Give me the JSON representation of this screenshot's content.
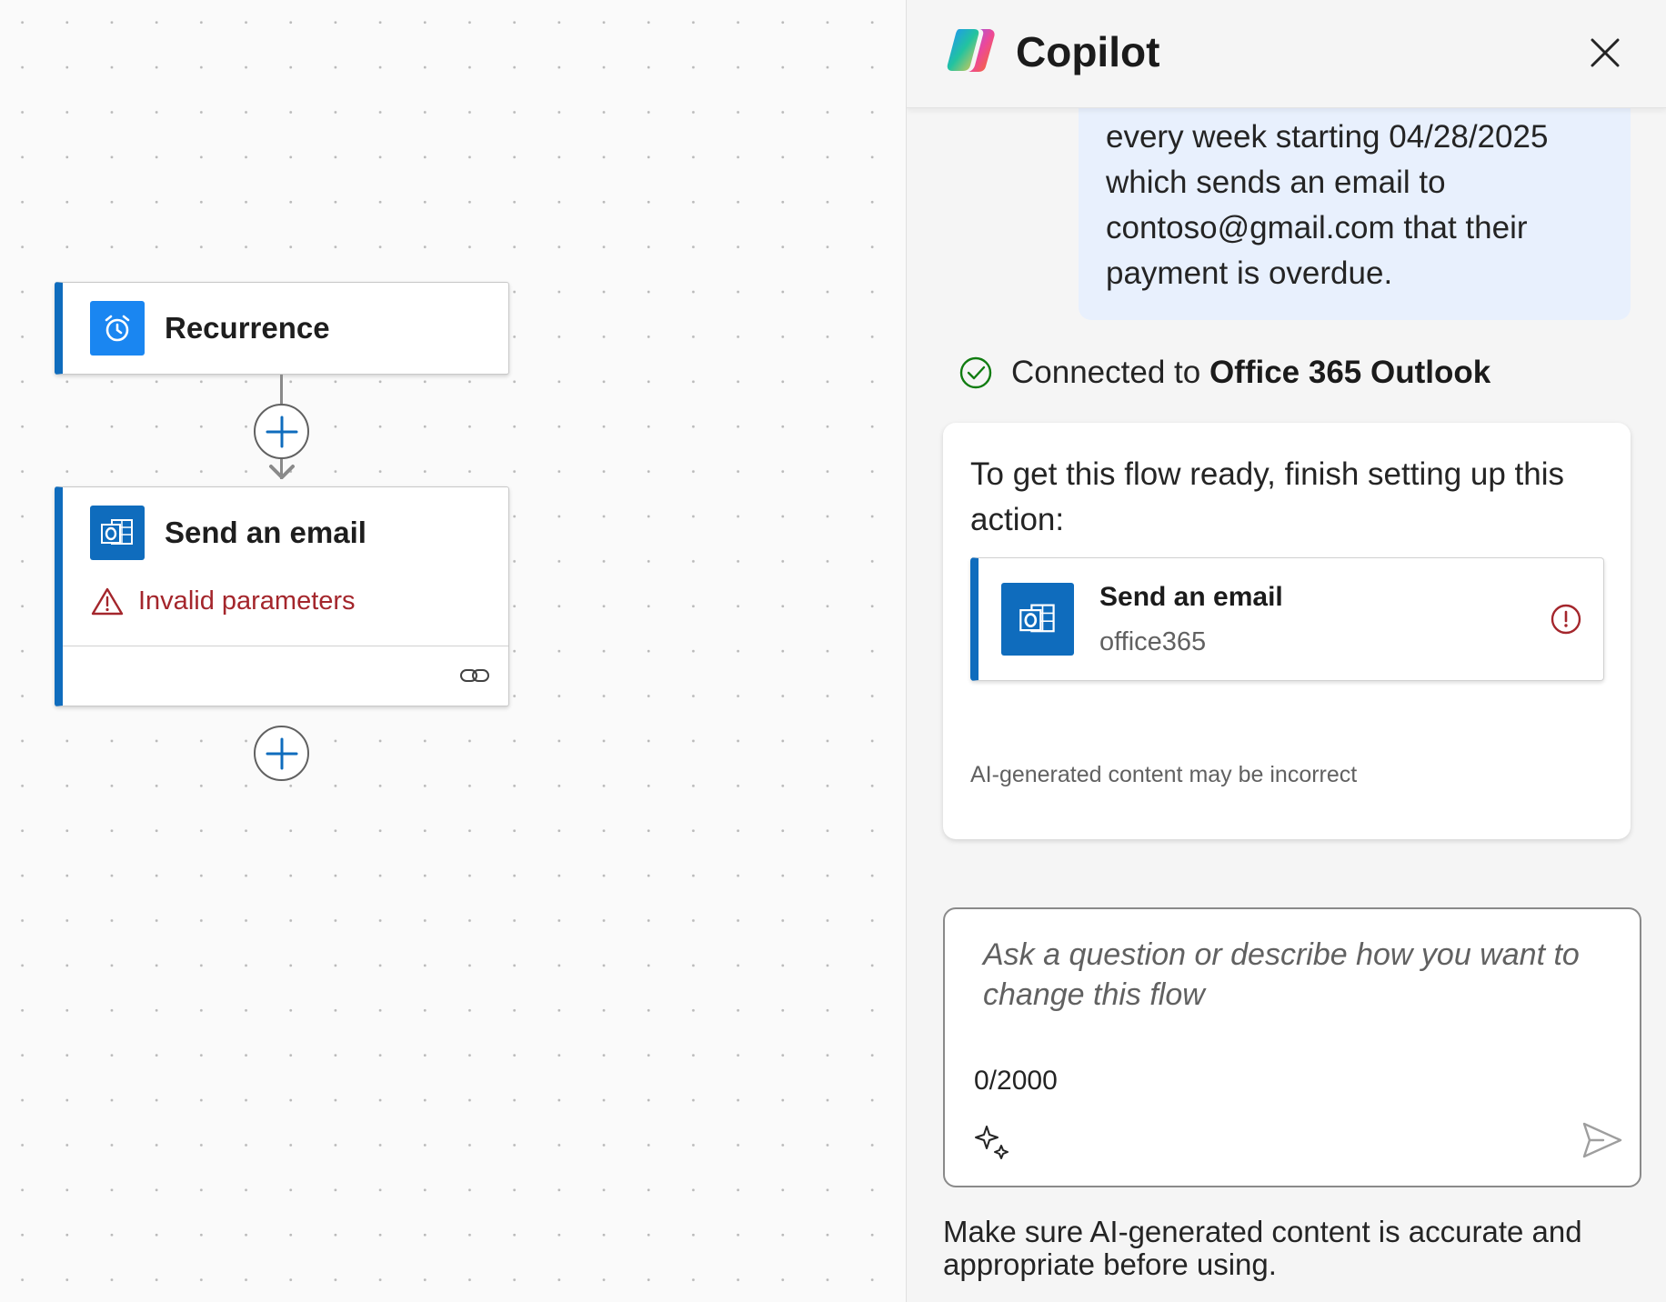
{
  "canvas": {
    "nodes": [
      {
        "title": "Recurrence",
        "icon": "alarm-clock-icon"
      },
      {
        "title": "Send an email",
        "icon": "outlook-icon",
        "error": "Invalid parameters",
        "footer_icon": "link-icon"
      }
    ],
    "add_buttons": [
      "plus-icon",
      "plus-icon"
    ]
  },
  "copilot": {
    "title": "Copilot",
    "user_message": "every week starting 04/28/2025 which sends an email to contoso@gmail.com that their payment is overdue.",
    "connected_prefix": "Connected to",
    "connected_service": "Office 365 Outlook",
    "setup_prompt": "To get this flow ready, finish setting up this action:",
    "action": {
      "title": "Send an email",
      "connector": "office365",
      "status_icon": "error-circle-icon"
    },
    "ai_note": "AI-generated content may be incorrect",
    "input": {
      "placeholder": "Ask a question or describe how you want to change this flow",
      "char_count": "0/2000"
    },
    "footer_disclaimer": "Make sure AI-generated content is accurate and appropriate before using."
  },
  "colors": {
    "accent": "#0f6cbd",
    "error": "#a4262c",
    "success": "#107c10",
    "bubble": "#e8f0fd"
  }
}
